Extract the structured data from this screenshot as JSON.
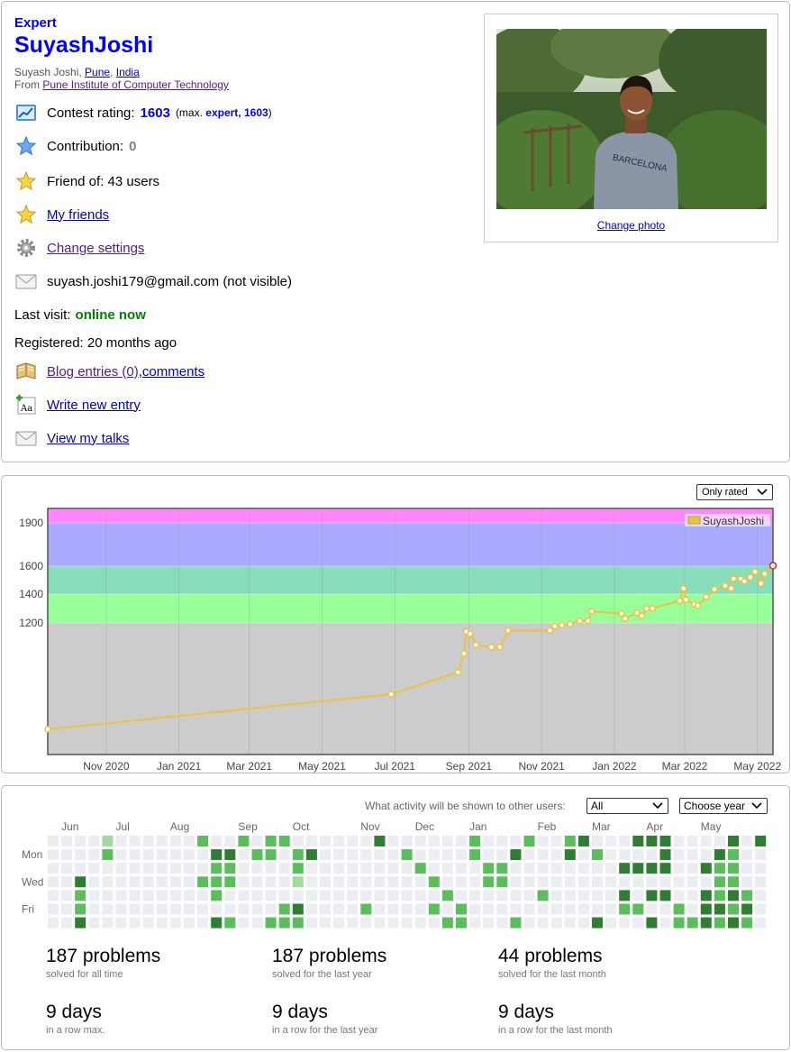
{
  "profile": {
    "rank": "Expert",
    "handle": "SuyashJoshi",
    "name_prefix": "Suyash Joshi, ",
    "city": "Pune",
    "country": "India",
    "from_prefix": "From ",
    "organization": "Pune Institute of Computer Technology",
    "contest_rating_label": "Contest rating:",
    "contest_rating_value": "1603",
    "max_open": "(max. ",
    "max_value": "expert, 1603",
    "max_close": ")",
    "contribution_label": "Contribution:",
    "contribution_value": "0",
    "friend_of": "Friend of: 43 users",
    "my_friends": "My friends",
    "change_settings": "Change settings",
    "email": "suyash.joshi179@gmail.com (not visible)",
    "last_visit_label": "Last visit:",
    "last_visit_value": "online now",
    "registered": "Registered: 20 months ago",
    "blog_entries": "Blog entries (0)",
    "blog_sep": ", ",
    "comments": "comments",
    "write_new_entry": "Write new entry",
    "view_my_talks": "View my talks",
    "change_photo": "Change photo"
  },
  "chart_data": {
    "type": "line",
    "filter_label": "Only rated",
    "legend": "SuyashJoshi",
    "series_color": "#edc240",
    "y_ticks": [
      1200,
      1400,
      1600,
      1900
    ],
    "x_ticks": [
      "Nov 2020",
      "Jan 2021",
      "Mar 2021",
      "May 2021",
      "Jul 2021",
      "Sep 2021",
      "Nov 2021",
      "Jan 2022",
      "Mar 2022",
      "May 2022"
    ],
    "rank_bands": [
      {
        "from": 0,
        "to": 1200,
        "color": "#cccccc"
      },
      {
        "from": 1200,
        "to": 1400,
        "color": "#99ff99"
      },
      {
        "from": 1400,
        "to": 1600,
        "color": "#88ddbb"
      },
      {
        "from": 1600,
        "to": 1900,
        "color": "#aaaaff"
      },
      {
        "from": 1900,
        "to": 2100,
        "color": "#ff88ff"
      }
    ],
    "points": [
      {
        "x": "2020-09-13",
        "y": 230
      },
      {
        "x": "2021-06-28",
        "y": 550
      },
      {
        "x": "2021-08-23",
        "y": 750
      },
      {
        "x": "2021-08-28",
        "y": 920
      },
      {
        "x": "2021-08-30",
        "y": 1120
      },
      {
        "x": "2021-09-02",
        "y": 1100
      },
      {
        "x": "2021-09-07",
        "y": 1000
      },
      {
        "x": "2021-09-20",
        "y": 980
      },
      {
        "x": "2021-09-27",
        "y": 980
      },
      {
        "x": "2021-10-04",
        "y": 1130
      },
      {
        "x": "2021-11-08",
        "y": 1130
      },
      {
        "x": "2021-11-12",
        "y": 1170
      },
      {
        "x": "2021-11-18",
        "y": 1180
      },
      {
        "x": "2021-11-25",
        "y": 1190
      },
      {
        "x": "2021-12-03",
        "y": 1215
      },
      {
        "x": "2021-12-10",
        "y": 1215
      },
      {
        "x": "2021-12-13",
        "y": 1280
      },
      {
        "x": "2022-01-07",
        "y": 1265
      },
      {
        "x": "2022-01-10",
        "y": 1230
      },
      {
        "x": "2022-01-20",
        "y": 1270
      },
      {
        "x": "2022-01-24",
        "y": 1250
      },
      {
        "x": "2022-01-28",
        "y": 1300
      },
      {
        "x": "2022-02-02",
        "y": 1300
      },
      {
        "x": "2022-02-25",
        "y": 1355
      },
      {
        "x": "2022-02-28",
        "y": 1440
      },
      {
        "x": "2022-03-02",
        "y": 1360
      },
      {
        "x": "2022-03-09",
        "y": 1330
      },
      {
        "x": "2022-03-12",
        "y": 1320
      },
      {
        "x": "2022-03-19",
        "y": 1380
      },
      {
        "x": "2022-03-26",
        "y": 1435
      },
      {
        "x": "2022-04-04",
        "y": 1460
      },
      {
        "x": "2022-04-09",
        "y": 1440
      },
      {
        "x": "2022-04-11",
        "y": 1510
      },
      {
        "x": "2022-04-17",
        "y": 1510
      },
      {
        "x": "2022-04-20",
        "y": 1490
      },
      {
        "x": "2022-04-25",
        "y": 1520
      },
      {
        "x": "2022-04-29",
        "y": 1560
      },
      {
        "x": "2022-05-04",
        "y": 1475
      },
      {
        "x": "2022-05-07",
        "y": 1545
      },
      {
        "x": "2022-05-14",
        "y": 1603
      }
    ]
  },
  "activity": {
    "question": "What activity will be shown to other users:",
    "visibility_value": "All",
    "year_value": "Choose year",
    "months": [
      "Jun",
      "Jul",
      "Aug",
      "Sep",
      "Oct",
      "Nov",
      "Dec",
      "Jan",
      "Feb",
      "Mar",
      "Apr",
      "May"
    ],
    "days": [
      "Mon",
      "Wed",
      "Fri"
    ],
    "weeks": 53,
    "month_week_index": [
      2,
      6,
      10,
      15,
      19,
      24,
      28,
      32,
      37,
      41,
      45,
      49
    ],
    "palette": [
      "#ebedf0",
      "#a2dba2",
      "#5bbd5b",
      "#2e7d32"
    ],
    "cells": [
      [
        5,
        0,
        1
      ],
      [
        5,
        1,
        2
      ],
      [
        3,
        3,
        3
      ],
      [
        3,
        4,
        2
      ],
      [
        3,
        5,
        2
      ],
      [
        3,
        6,
        3
      ],
      [
        12,
        0,
        2
      ],
      [
        15,
        0,
        2
      ],
      [
        14,
        1,
        2
      ],
      [
        13,
        1,
        3
      ],
      [
        14,
        2,
        2
      ],
      [
        13,
        2,
        2
      ],
      [
        14,
        3,
        2
      ],
      [
        12,
        3,
        2
      ],
      [
        13,
        3,
        2
      ],
      [
        13,
        4,
        2
      ],
      [
        13,
        6,
        3
      ],
      [
        14,
        6,
        2
      ],
      [
        14,
        1,
        3
      ],
      [
        16,
        1,
        2
      ],
      [
        17,
        0,
        2
      ],
      [
        17,
        1,
        2
      ],
      [
        18,
        0,
        2
      ],
      [
        19,
        1,
        2
      ],
      [
        19,
        2,
        2
      ],
      [
        19,
        3,
        1
      ],
      [
        19,
        6,
        2
      ],
      [
        20,
        1,
        3
      ],
      [
        18,
        5,
        2
      ],
      [
        19,
        5,
        3
      ],
      [
        18,
        6,
        2
      ],
      [
        17,
        6,
        2
      ],
      [
        25,
        0,
        3
      ],
      [
        24,
        5,
        2
      ],
      [
        27,
        1,
        2
      ],
      [
        28,
        2,
        2
      ],
      [
        29,
        3,
        2
      ],
      [
        29,
        5,
        2
      ],
      [
        30,
        4,
        2
      ],
      [
        31,
        5,
        2
      ],
      [
        30,
        6,
        2
      ],
      [
        31,
        6,
        2
      ],
      [
        32,
        0,
        2
      ],
      [
        32,
        1,
        2
      ],
      [
        33,
        2,
        2
      ],
      [
        34,
        2,
        2
      ],
      [
        33,
        3,
        2
      ],
      [
        34,
        3,
        2
      ],
      [
        35,
        1,
        3
      ],
      [
        36,
        0,
        2
      ],
      [
        35,
        6,
        2
      ],
      [
        37,
        4,
        2
      ],
      [
        39,
        0,
        2
      ],
      [
        39,
        1,
        3
      ],
      [
        40,
        0,
        3
      ],
      [
        41,
        1,
        2
      ],
      [
        41,
        6,
        3
      ],
      [
        43,
        2,
        3
      ],
      [
        44,
        2,
        3
      ],
      [
        45,
        2,
        3
      ],
      [
        46,
        2,
        3
      ],
      [
        44,
        0,
        3
      ],
      [
        45,
        0,
        3
      ],
      [
        46,
        0,
        3
      ],
      [
        46,
        1,
        3
      ],
      [
        43,
        4,
        3
      ],
      [
        45,
        4,
        3
      ],
      [
        46,
        4,
        3
      ],
      [
        44,
        5,
        2
      ],
      [
        43,
        5,
        2
      ],
      [
        45,
        6,
        3
      ],
      [
        47,
        5,
        2
      ],
      [
        48,
        6,
        2
      ],
      [
        49,
        2,
        3
      ],
      [
        50,
        2,
        2
      ],
      [
        51,
        2,
        2
      ],
      [
        49,
        5,
        3
      ],
      [
        50,
        3,
        2
      ],
      [
        51,
        3,
        2
      ],
      [
        50,
        4,
        2
      ],
      [
        51,
        4,
        3
      ],
      [
        52,
        4,
        2
      ],
      [
        50,
        5,
        3
      ],
      [
        51,
        5,
        2
      ],
      [
        52,
        5,
        3
      ],
      [
        50,
        6,
        2
      ],
      [
        51,
        6,
        3
      ],
      [
        52,
        6,
        2
      ],
      [
        51,
        0,
        3
      ],
      [
        53,
        0,
        3
      ],
      [
        50,
        1,
        3
      ],
      [
        51,
        1,
        2
      ],
      [
        49,
        4,
        3
      ],
      [
        49,
        6,
        3
      ],
      [
        47,
        6,
        2
      ]
    ],
    "stats": [
      {
        "big": "187 problems",
        "small": "solved for all time"
      },
      {
        "big": "187 problems",
        "small": "solved for the last year"
      },
      {
        "big": "44 problems",
        "small": "solved for the last month"
      },
      {
        "big": "9 days",
        "small": "in a row max."
      },
      {
        "big": "9 days",
        "small": "in a row for the last year"
      },
      {
        "big": "9 days",
        "small": "in a row for the last month"
      }
    ]
  }
}
